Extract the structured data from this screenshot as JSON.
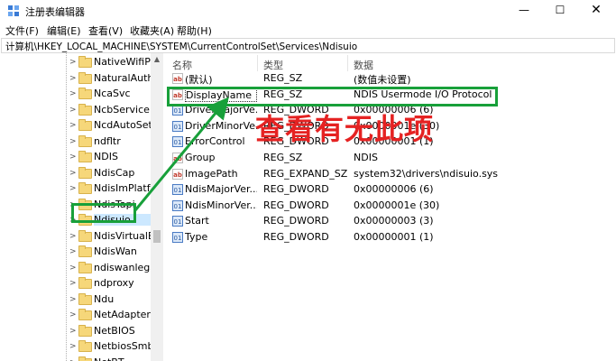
{
  "window": {
    "title": "注册表编辑器",
    "min_glyph": "—",
    "max_glyph": "☐",
    "close_glyph": "✕",
    "icon": "registry-editor-icon"
  },
  "menu": [
    "文件(F)",
    "编辑(E)",
    "查看(V)",
    "收藏夹(A)",
    "帮助(H)"
  ],
  "address": "计算机\\HKEY_LOCAL_MACHINE\\SYSTEM\\CurrentControlSet\\Services\\Ndisuio",
  "tree": {
    "items": [
      {
        "label": "NativeWifiP",
        "expander": ">"
      },
      {
        "label": "NaturalAuthe",
        "expander": ">"
      },
      {
        "label": "NcaSvc",
        "expander": ">"
      },
      {
        "label": "NcbService",
        "expander": ">"
      },
      {
        "label": "NcdAutoSetu",
        "expander": ">"
      },
      {
        "label": "ndfltr",
        "expander": ">"
      },
      {
        "label": "NDIS",
        "expander": ">"
      },
      {
        "label": "NdisCap",
        "expander": ">"
      },
      {
        "label": "NdisImPlatfo",
        "expander": ">"
      },
      {
        "label": "NdisTapi",
        "expander": ">"
      },
      {
        "label": "Ndisuio",
        "expander": ">",
        "selected": true
      },
      {
        "label": "NdisVirtualBr",
        "expander": ">"
      },
      {
        "label": "NdisWan",
        "expander": ">"
      },
      {
        "label": "ndiswanlegac",
        "expander": ">"
      },
      {
        "label": "ndproxy",
        "expander": ">"
      },
      {
        "label": "Ndu",
        "expander": ">"
      },
      {
        "label": "NetAdapterC",
        "expander": ">"
      },
      {
        "label": "NetBIOS",
        "expander": ">"
      },
      {
        "label": "NetbiosSmb",
        "expander": ">"
      },
      {
        "label": "NetBT",
        "expander": ">"
      }
    ],
    "scroll_up_glyph": "▲"
  },
  "list": {
    "headers": {
      "name": "名称",
      "type": "类型",
      "data": "数据"
    },
    "rows": [
      {
        "icon": "ab",
        "kind": "sz",
        "name": "(默认)",
        "type": "REG_SZ",
        "data": "(数值未设置)"
      },
      {
        "icon": "ab",
        "kind": "sz",
        "name": "DisplayName",
        "type": "REG_SZ",
        "data": "NDIS Usermode I/O Protocol",
        "focused": true
      },
      {
        "icon": "01",
        "kind": "dw",
        "name": "DriverMajorVe...",
        "type": "REG_DWORD",
        "data": "0x00000006 (6)"
      },
      {
        "icon": "01",
        "kind": "dw",
        "name": "DriverMinorVe...",
        "type": "REG_DWORD",
        "data": "0x0000001e (30)"
      },
      {
        "icon": "01",
        "kind": "dw",
        "name": "ErrorControl",
        "type": "REG_DWORD",
        "data": "0x00000001 (1)"
      },
      {
        "icon": "ab",
        "kind": "sz",
        "name": "Group",
        "type": "REG_SZ",
        "data": "NDIS"
      },
      {
        "icon": "ab",
        "kind": "sz",
        "name": "ImagePath",
        "type": "REG_EXPAND_SZ",
        "data": "system32\\drivers\\ndisuio.sys"
      },
      {
        "icon": "01",
        "kind": "dw",
        "name": "NdisMajorVer...",
        "type": "REG_DWORD",
        "data": "0x00000006 (6)"
      },
      {
        "icon": "01",
        "kind": "dw",
        "name": "NdisMinorVer...",
        "type": "REG_DWORD",
        "data": "0x0000001e (30)"
      },
      {
        "icon": "01",
        "kind": "dw",
        "name": "Start",
        "type": "REG_DWORD",
        "data": "0x00000003 (3)"
      },
      {
        "icon": "01",
        "kind": "dw",
        "name": "Type",
        "type": "REG_DWORD",
        "data": "0x00000001 (1)"
      }
    ]
  },
  "annotation": {
    "text": "查看有无此项",
    "text_color": "#e52222",
    "highlight_color": "#18a03a"
  }
}
